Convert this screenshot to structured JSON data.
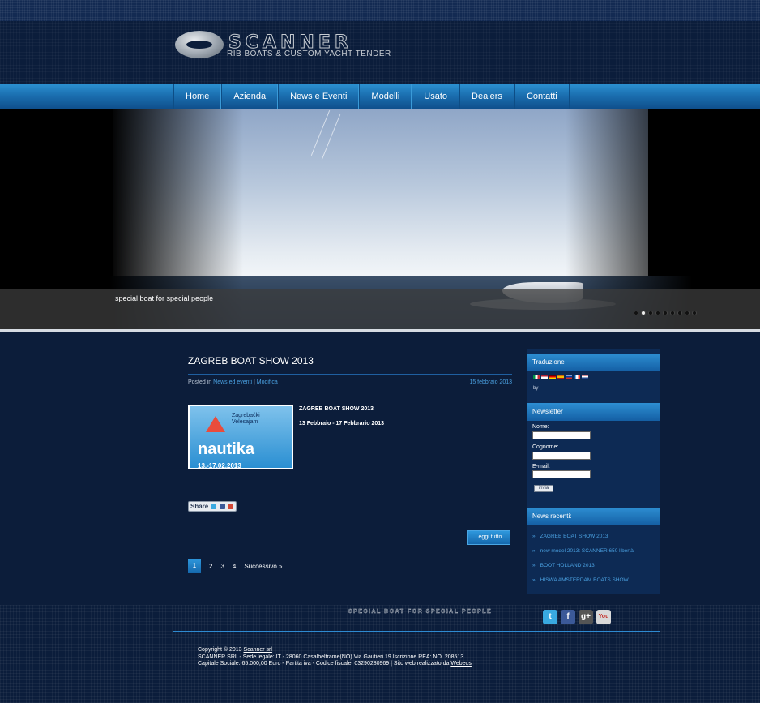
{
  "brand": {
    "name": "SCANNER",
    "tagline": "RIB BOATS & CUSTOM YACHT TENDER"
  },
  "nav": {
    "items": [
      {
        "label": "Home"
      },
      {
        "label": "Azienda"
      },
      {
        "label": "News e Eventi"
      },
      {
        "label": "Modelli"
      },
      {
        "label": "Usato"
      },
      {
        "label": "Dealers"
      },
      {
        "label": "Contatti"
      }
    ]
  },
  "hero": {
    "caption": "special boat for special people",
    "slides_count": 9,
    "active_slide": 2
  },
  "post": {
    "title": "ZAGREB BOAT SHOW 2013",
    "posted_in_label": "Posted in",
    "category": "News ed eventi",
    "separator": "|",
    "edit_label": "Modifica",
    "date": "15 febbraio 2013",
    "thumbnail": {
      "brand_line1": "Zagrebački",
      "brand_line2": "Velesajam",
      "word": "nautika",
      "dates": "13.-17.02.2013"
    },
    "excerpt_title": "ZAGREB BOAT SHOW 2013",
    "excerpt_dates": "13 Febbraio - 17 Febbrario 2013",
    "share_label": "Share",
    "read_all_label": "Leggi tutto"
  },
  "pagination": {
    "pages": [
      "1",
      "2",
      "3",
      "4"
    ],
    "current": "1",
    "next_label": "Successivo »"
  },
  "sidebar": {
    "translation": {
      "heading": "Traduzione",
      "by_label": "by"
    },
    "newsletter": {
      "heading": "Newsletter",
      "name_label": "Nome:",
      "surname_label": "Cognome:",
      "email_label": "E-mail:",
      "submit_label": "invia"
    },
    "recent": {
      "heading": "News recenti:",
      "items": [
        {
          "label": "ZAGREB BOAT SHOW 2013"
        },
        {
          "label": "new model 2013: SCANNER 650 libertà"
        },
        {
          "label": "BOOT HOLLAND 2013"
        },
        {
          "label": "HISWA AMSTERDAM BOATS SHOW"
        }
      ]
    }
  },
  "footer": {
    "slogan": "SPECIAL BOAT FOR SPECIAL PEOPLE",
    "copyright_prefix": "Copyright © 2013",
    "company_link": "Scanner srl",
    "line2": "SCANNER SRL - Sede legale: IT - 28060 Casalbeltrame(NO) Via Gautieri 19 Iscrizione REA: NO. 208513",
    "line3_prefix": "Capitale Sociale: 65.000,00 Euro - Partita iva - Codice fiscale: 03290280969 | Sito web realizzato da",
    "webmaster_link": "Webeos",
    "social": {
      "twitter": "t",
      "facebook": "f",
      "google_plus": "g+",
      "youtube": "You"
    }
  },
  "colors": {
    "page_bg": "#0d1f3e",
    "nav_blue": "#1b6fb0",
    "link_blue": "#4aa0e0"
  }
}
